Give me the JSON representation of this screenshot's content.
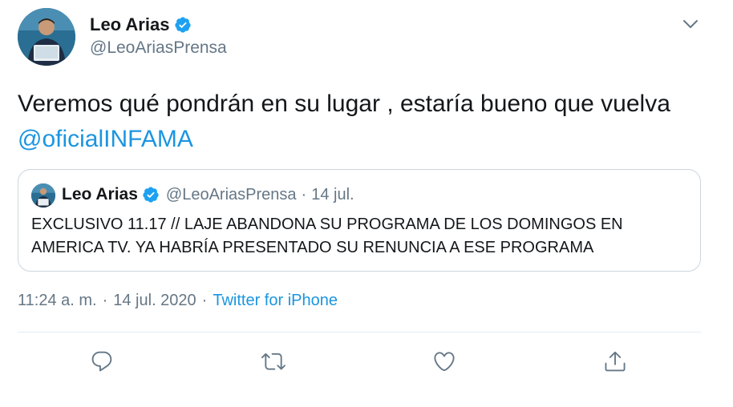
{
  "author": {
    "display_name": "Leo Arias",
    "handle": "@LeoAriasPrensa",
    "verified": true
  },
  "tweet": {
    "text": "Veremos qué pondrán en su lugar , estaría bueno que vuelva ",
    "mention": "@oficialINFAMA"
  },
  "quoted_tweet": {
    "display_name": "Leo Arias",
    "handle": "@LeoAriasPrensa",
    "separator": "·",
    "date": "14 jul.",
    "text": "EXCLUSIVO 11.17 // LAJE ABANDONA SU PROGRAMA DE LOS DOMINGOS EN AMERICA TV. YA HABRÍA PRESENTADO SU RENUNCIA A ESE PROGRAMA"
  },
  "meta": {
    "time": "11:24 a. m.",
    "separator1": "·",
    "date": "14 jul. 2020",
    "separator2": "·",
    "source": "Twitter for iPhone"
  },
  "actions": {
    "reply_icon": "reply-icon",
    "retweet_icon": "retweet-icon",
    "like_icon": "heart-icon",
    "share_icon": "share-icon"
  },
  "colors": {
    "link": "#1b95e0",
    "secondary_text": "#657786",
    "verified": "#1da1f2",
    "icon": "#657786"
  }
}
